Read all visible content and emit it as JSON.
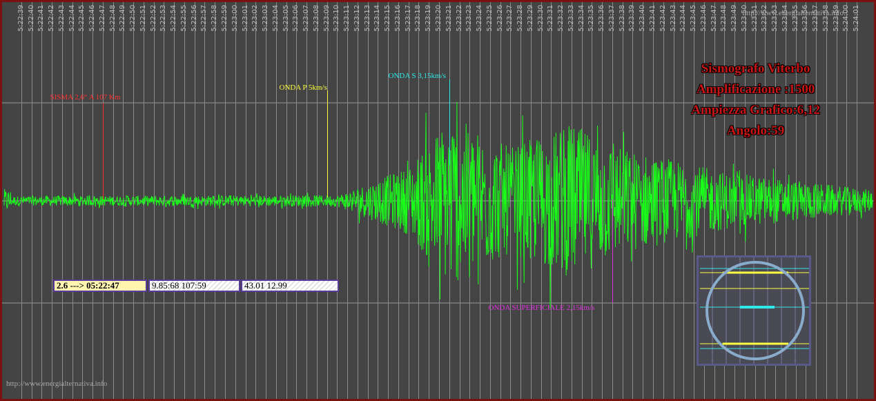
{
  "watermark_top": "http://www.energialternativa.info",
  "watermark_bottom": "http://www.energialternativa.info",
  "info_lines": [
    "Sismografo Viterbo",
    "Amplificazione :1500",
    "Ampiezza Grafico:6,12",
    "Angolo:59"
  ],
  "info_boxes": [
    "2.6 ---> 05:22:47",
    "9.85:68 107:59",
    "43.01 12.99"
  ],
  "colors": {
    "background": "#444444",
    "trace": "#19ff19",
    "sisma": "#ff3030",
    "onda_p": "#ffff40",
    "onda_s": "#30e8e8",
    "onda_superficiale": "#e030e0",
    "info_text": "#c81414"
  },
  "chart_data": {
    "type": "line",
    "title": "Sismografo Viterbo",
    "x_tick_labels": [
      "5:22:39",
      "5:22:40",
      "5:22:41",
      "5:22:42",
      "5:22:43",
      "5:22:44",
      "5:22:45",
      "5:22:46",
      "5:22:47",
      "5:22:48",
      "5:22:49",
      "5:22:50",
      "5:22:51",
      "5:22:52",
      "5:22:53",
      "5:22:54",
      "5:22:55",
      "5:22:56",
      "5:22:57",
      "5:22:58",
      "5:22:59",
      "5:23:00",
      "5:23:01",
      "5:23:02",
      "5:23:03",
      "5:23:04",
      "5:23:05",
      "5:23:06",
      "5:23:07",
      "5:23:08",
      "5:23:09",
      "5:23:10",
      "5:23:11",
      "5:23:12",
      "5:23:13",
      "5:23:14",
      "5:23:15",
      "5:23:16",
      "5:23:17",
      "5:23:18",
      "5:23:19",
      "5:23:20",
      "5:23:21",
      "5:23:22",
      "5:23:23",
      "5:23:24",
      "5:23:25",
      "5:23:26",
      "5:23:27",
      "5:23:28",
      "5:23:29",
      "5:23:30",
      "5:23:31",
      "5:23:32",
      "5:23:33",
      "5:23:34",
      "5:23:35",
      "5:23:36",
      "5:23:37",
      "5:23:38",
      "5:23:39",
      "5:23:40",
      "5:23:41",
      "5:23:42",
      "5:23:43",
      "5:23:44",
      "5:23:45",
      "5:23:46",
      "5:23:47",
      "5:23:48",
      "5:23:49",
      "5:23:50",
      "5:23:51",
      "5:23:52",
      "5:23:53",
      "5:23:54",
      "5:23:55",
      "5:23:56",
      "5:23:57",
      "5:23:58",
      "5:23:59",
      "5:24:00",
      "5:24:01"
    ],
    "x_range": [
      "5:22:38",
      "5:24:02"
    ],
    "y_range": [
      -1,
      1
    ],
    "grid": true,
    "events": [
      {
        "name": "sisma",
        "label": "SISMA 2,6° A 107 Km",
        "time": "5:22:47",
        "color": "#ff3030"
      },
      {
        "name": "onda-p",
        "label": "ONDA P 5km/s",
        "time": "5:23:09",
        "color": "#ffff40"
      },
      {
        "name": "onda-s",
        "label": "ONDA S 3,15km/s",
        "time": "5:23:21",
        "color": "#30e8e8"
      },
      {
        "name": "onda-superficiale",
        "label": "ONDA SUPERFICIALE 2,15km/s",
        "time": "5:23:37",
        "color": "#e030e0"
      }
    ],
    "envelope": [
      {
        "time": "5:22:38",
        "amplitude": 0.05
      },
      {
        "time": "5:23:10",
        "amplitude": 0.06
      },
      {
        "time": "5:23:17",
        "amplitude": 0.35
      },
      {
        "time": "5:23:21",
        "amplitude": 0.9
      },
      {
        "time": "5:23:27",
        "amplitude": 0.55
      },
      {
        "time": "5:23:33",
        "amplitude": 0.8
      },
      {
        "time": "5:23:38",
        "amplitude": 0.55
      },
      {
        "time": "5:23:48",
        "amplitude": 0.3
      },
      {
        "time": "5:24:02",
        "amplitude": 0.12
      }
    ]
  }
}
